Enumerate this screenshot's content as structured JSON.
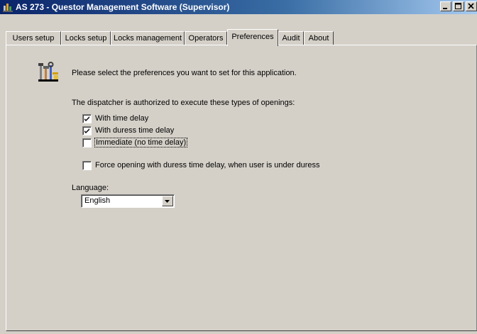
{
  "window": {
    "title": "AS 273 - Questor Management Software (Supervisor)"
  },
  "tabs": [
    {
      "label": "Users setup"
    },
    {
      "label": "Locks setup"
    },
    {
      "label": "Locks management"
    },
    {
      "label": "Operators"
    },
    {
      "label": "Preferences",
      "active": true
    },
    {
      "label": "Audit"
    },
    {
      "label": "About"
    }
  ],
  "preferences": {
    "intro": "Please select the preferences you want to set for this application.",
    "dispatcher_text": "The dispatcher is authorized to execute these types of openings:",
    "options": [
      {
        "label": "With time delay",
        "checked": true
      },
      {
        "label": "With duress time delay",
        "checked": true
      },
      {
        "label": "Immediate (no time delay)",
        "checked": false
      }
    ],
    "force_option": {
      "label": "Force opening with duress time delay, when user is under duress",
      "checked": false
    },
    "language_label": "Language:",
    "language_value": "English"
  },
  "icons": {
    "app": "tools-icon",
    "window": "app-window-icon"
  }
}
